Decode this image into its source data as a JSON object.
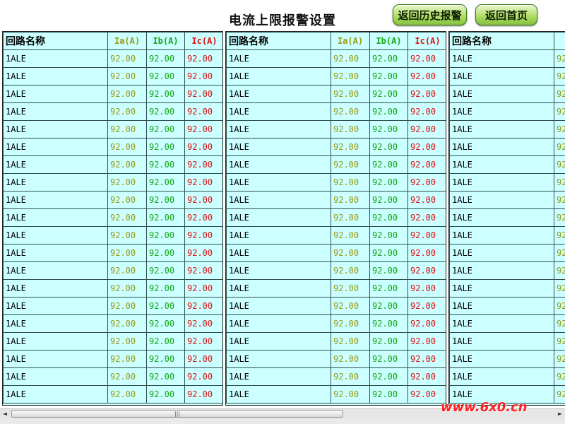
{
  "title": "电流上限报警设置",
  "buttons": {
    "history_label": "返回历史报警",
    "home_label": "返回首页"
  },
  "table_headers": {
    "name": "回路名称",
    "ia": "Ia(A)",
    "ib": "Ib(A)",
    "ic": "Ic(A)"
  },
  "panels": [
    {
      "rows": [
        {
          "name": "1ALE",
          "ia": "92.00",
          "ib": "92.00",
          "ic": "92.00"
        },
        {
          "name": "1ALE",
          "ia": "92.00",
          "ib": "92.00",
          "ic": "92.00"
        },
        {
          "name": "1ALE",
          "ia": "92.00",
          "ib": "92.00",
          "ic": "92.00"
        },
        {
          "name": "1ALE",
          "ia": "92.00",
          "ib": "92.00",
          "ic": "92.00"
        },
        {
          "name": "1ALE",
          "ia": "92.00",
          "ib": "92.00",
          "ic": "92.00"
        },
        {
          "name": "1ALE",
          "ia": "92.00",
          "ib": "92.00",
          "ic": "92.00"
        },
        {
          "name": "1ALE",
          "ia": "92.00",
          "ib": "92.00",
          "ic": "92.00"
        },
        {
          "name": "1ALE",
          "ia": "92.00",
          "ib": "92.00",
          "ic": "92.00"
        },
        {
          "name": "1ALE",
          "ia": "92.00",
          "ib": "92.00",
          "ic": "92.00"
        },
        {
          "name": "1ALE",
          "ia": "92.00",
          "ib": "92.00",
          "ic": "92.00"
        },
        {
          "name": "1ALE",
          "ia": "92.00",
          "ib": "92.00",
          "ic": "92.00"
        },
        {
          "name": "1ALE",
          "ia": "92.00",
          "ib": "92.00",
          "ic": "92.00"
        },
        {
          "name": "1ALE",
          "ia": "92.00",
          "ib": "92.00",
          "ic": "92.00"
        },
        {
          "name": "1ALE",
          "ia": "92.00",
          "ib": "92.00",
          "ic": "92.00"
        },
        {
          "name": "1ALE",
          "ia": "92.00",
          "ib": "92.00",
          "ic": "92.00"
        },
        {
          "name": "1ALE",
          "ia": "92.00",
          "ib": "92.00",
          "ic": "92.00"
        },
        {
          "name": "1ALE",
          "ia": "92.00",
          "ib": "92.00",
          "ic": "92.00"
        },
        {
          "name": "1ALE",
          "ia": "92.00",
          "ib": "92.00",
          "ic": "92.00"
        },
        {
          "name": "1ALE",
          "ia": "92.00",
          "ib": "92.00",
          "ic": "92.00"
        },
        {
          "name": "1ALE",
          "ia": "92.00",
          "ib": "92.00",
          "ic": "92.00"
        }
      ]
    },
    {
      "rows": [
        {
          "name": "1ALE",
          "ia": "92.00",
          "ib": "92.00",
          "ic": "92.00"
        },
        {
          "name": "1ALE",
          "ia": "92.00",
          "ib": "92.00",
          "ic": "92.00"
        },
        {
          "name": "1ALE",
          "ia": "92.00",
          "ib": "92.00",
          "ic": "92.00"
        },
        {
          "name": "1ALE",
          "ia": "92.00",
          "ib": "92.00",
          "ic": "92.00"
        },
        {
          "name": "1ALE",
          "ia": "92.00",
          "ib": "92.00",
          "ic": "92.00"
        },
        {
          "name": "1ALE",
          "ia": "92.00",
          "ib": "92.00",
          "ic": "92.00"
        },
        {
          "name": "1ALE",
          "ia": "92.00",
          "ib": "92.00",
          "ic": "92.00"
        },
        {
          "name": "1ALE",
          "ia": "92.00",
          "ib": "92.00",
          "ic": "92.00"
        },
        {
          "name": "1ALE",
          "ia": "92.00",
          "ib": "92.00",
          "ic": "92.00"
        },
        {
          "name": "1ALE",
          "ia": "92.00",
          "ib": "92.00",
          "ic": "92.00"
        },
        {
          "name": "1ALE",
          "ia": "92.00",
          "ib": "92.00",
          "ic": "92.00"
        },
        {
          "name": "1ALE",
          "ia": "92.00",
          "ib": "92.00",
          "ic": "92.00"
        },
        {
          "name": "1ALE",
          "ia": "92.00",
          "ib": "92.00",
          "ic": "92.00"
        },
        {
          "name": "1ALE",
          "ia": "92.00",
          "ib": "92.00",
          "ic": "92.00"
        },
        {
          "name": "1ALE",
          "ia": "92.00",
          "ib": "92.00",
          "ic": "92.00"
        },
        {
          "name": "1ALE",
          "ia": "92.00",
          "ib": "92.00",
          "ic": "92.00"
        },
        {
          "name": "1ALE",
          "ia": "92.00",
          "ib": "92.00",
          "ic": "92.00"
        },
        {
          "name": "1ALE",
          "ia": "92.00",
          "ib": "92.00",
          "ic": "92.00"
        },
        {
          "name": "1ALE",
          "ia": "92.00",
          "ib": "92.00",
          "ic": "92.00"
        },
        {
          "name": "1ALE",
          "ia": "92.00",
          "ib": "92.00",
          "ic": "92.00"
        }
      ]
    },
    {
      "rows": [
        {
          "name": "1ALE",
          "ia": "92"
        },
        {
          "name": "1ALE",
          "ia": "92"
        },
        {
          "name": "1ALE",
          "ia": "92"
        },
        {
          "name": "1ALE",
          "ia": "92"
        },
        {
          "name": "1ALE",
          "ia": "92"
        },
        {
          "name": "1ALE",
          "ia": "92"
        },
        {
          "name": "1ALE",
          "ia": "92"
        },
        {
          "name": "1ALE",
          "ia": "92"
        },
        {
          "name": "1ALE",
          "ia": "92"
        },
        {
          "name": "1ALE",
          "ia": "92"
        },
        {
          "name": "1ALE",
          "ia": "92"
        },
        {
          "name": "1ALE",
          "ia": "92"
        },
        {
          "name": "1ALE",
          "ia": "92"
        },
        {
          "name": "1ALE",
          "ia": "92"
        },
        {
          "name": "1ALE",
          "ia": "92"
        },
        {
          "name": "1ALE",
          "ia": "92"
        },
        {
          "name": "1ALE",
          "ia": "92"
        },
        {
          "name": "1ALE",
          "ia": "92"
        },
        {
          "name": "1ALE",
          "ia": "92"
        },
        {
          "name": "1ALE",
          "ia": "92"
        }
      ]
    }
  ],
  "panel3_header_ia": "I",
  "scrollbar": {
    "left_arrow": "◄",
    "right_arrow": "►",
    "grip": "|||"
  },
  "watermark": "www.6x0.cn",
  "colors": {
    "panel_bg": "#ccffff",
    "ia": "#9a9a10",
    "ib": "#15a515",
    "ic": "#e01010",
    "button_green": "#b6e070"
  }
}
